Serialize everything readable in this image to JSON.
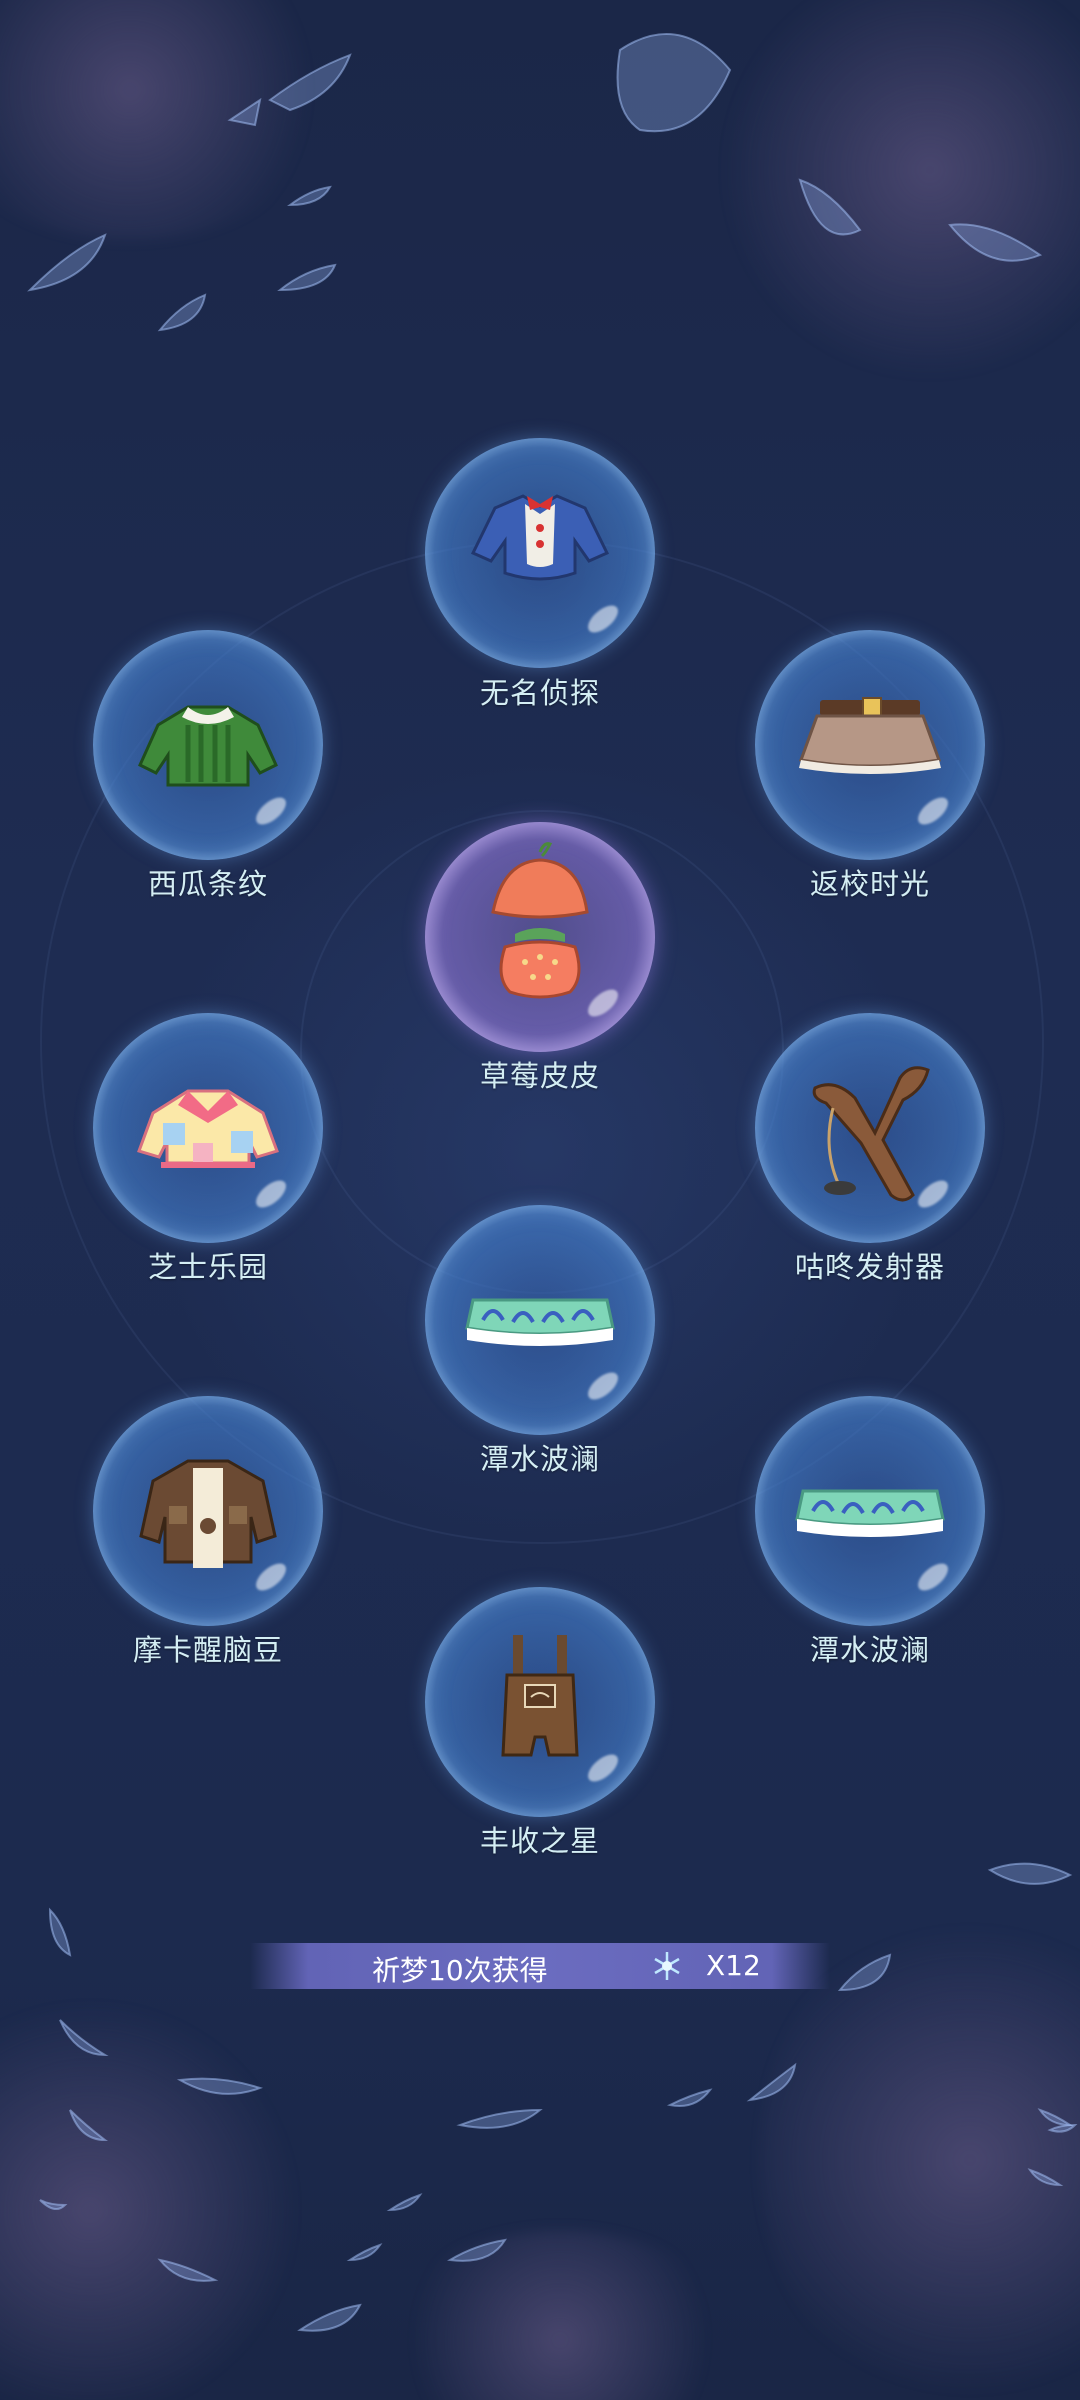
{
  "items": [
    {
      "name": "无名侦探",
      "icon": "detective-coat-icon"
    },
    {
      "name": "西瓜条纹",
      "icon": "watermelon-jacket-icon"
    },
    {
      "name": "返校时光",
      "icon": "school-skirt-icon"
    },
    {
      "name": "草莓皮皮",
      "icon": "strawberry-outfit-icon",
      "highlight": true
    },
    {
      "name": "芝士乐园",
      "icon": "cheese-jacket-icon"
    },
    {
      "name": "咕咚发射器",
      "icon": "slingshot-icon"
    },
    {
      "name": "潭水波澜",
      "icon": "wave-skirt-icon"
    },
    {
      "name": "摩卡醒脑豆",
      "icon": "mocha-vest-icon"
    },
    {
      "name": "潭水波澜",
      "icon": "wave-skirt-icon"
    },
    {
      "name": "丰收之星",
      "icon": "overalls-icon"
    }
  ],
  "banner": {
    "text": "祈梦10次获得",
    "count": "X12",
    "icon": "dream-crystal-icon"
  },
  "colors": {
    "background": "#1d2a4f",
    "label": "#d4eef4",
    "banner": "#6b6cc0"
  }
}
